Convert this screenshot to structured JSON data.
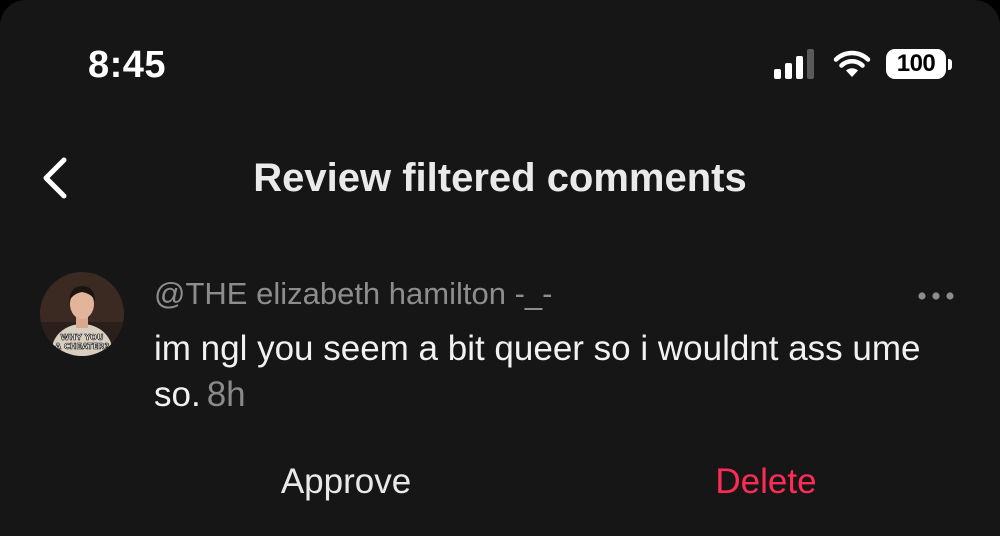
{
  "status_bar": {
    "time": "8:45",
    "battery_level": "100",
    "icons": [
      "signal-icon",
      "wifi-icon",
      "battery-icon"
    ]
  },
  "header": {
    "title": "Review filtered comments",
    "back_icon": "chevron-left-icon"
  },
  "comment": {
    "username": "@THE elizabeth hamilton -_-",
    "text": "im ngl you seem a bit queer so i wouldnt ass ume so.",
    "time": "8h",
    "avatar_caption_line1": "WHY YOU",
    "avatar_caption_line2": "A CHEATER?",
    "more_icon": "more-horizontal-icon"
  },
  "actions": {
    "approve_label": "Approve",
    "delete_label": "Delete"
  },
  "colors": {
    "background": "#161616",
    "delete_accent": "#fe2c55",
    "secondary_text": "#8d8d8d"
  }
}
